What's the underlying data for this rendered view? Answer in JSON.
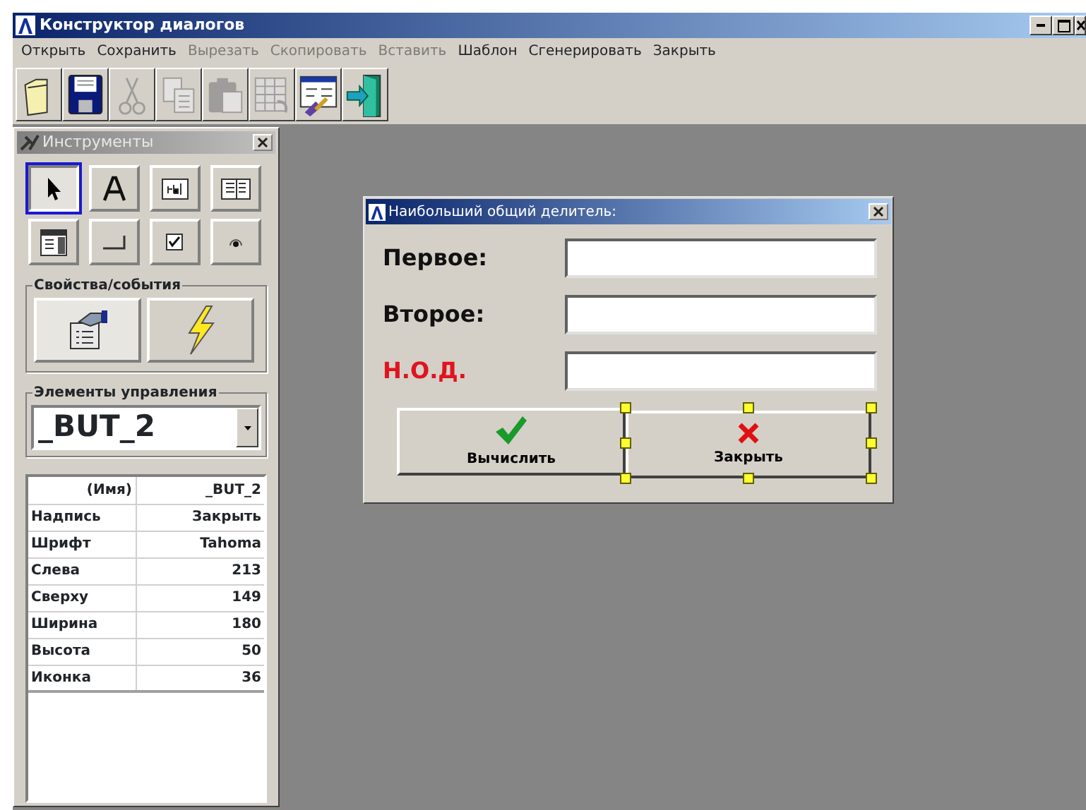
{
  "window": {
    "title": "Конструктор диалогов"
  },
  "menu": [
    {
      "label": "Открыть",
      "disabled": false
    },
    {
      "label": "Сохранить",
      "disabled": false
    },
    {
      "label": "Вырезать",
      "disabled": true
    },
    {
      "label": "Скопировать",
      "disabled": true
    },
    {
      "label": "Вставить",
      "disabled": true
    },
    {
      "label": "Шаблон",
      "disabled": false
    },
    {
      "label": "Сгенерировать",
      "disabled": false
    },
    {
      "label": "Закрыть",
      "disabled": false
    }
  ],
  "toolbar": [
    {
      "kind": "open",
      "disabled": false
    },
    {
      "kind": "save",
      "disabled": false
    },
    {
      "kind": "cut",
      "disabled": true
    },
    {
      "kind": "copy",
      "disabled": true
    },
    {
      "kind": "paste",
      "disabled": true
    },
    {
      "kind": "grid",
      "disabled": true
    },
    {
      "kind": "form",
      "disabled": false
    },
    {
      "kind": "exit",
      "disabled": false
    }
  ],
  "tools_panel": {
    "title": "Инструменты",
    "tools": [
      {
        "kind": "pointer",
        "selected": true
      },
      {
        "kind": "label",
        "selected": false
      },
      {
        "kind": "edit",
        "selected": false
      },
      {
        "kind": "list",
        "selected": false
      },
      {
        "kind": "combo",
        "selected": false
      },
      {
        "kind": "static",
        "selected": false
      },
      {
        "kind": "check",
        "selected": false
      },
      {
        "kind": "radio",
        "selected": false
      }
    ],
    "props_group": {
      "label": "Свойства/события"
    },
    "controls_group": {
      "label": "Элементы управления",
      "value": "_BUT_2"
    },
    "properties": [
      {
        "name": "(Имя)",
        "value": "_BUT_2"
      },
      {
        "name": "Надпись",
        "value": "Закрыть"
      },
      {
        "name": "Шрифт",
        "value": "Tahoma"
      },
      {
        "name": "Слева",
        "value": "213"
      },
      {
        "name": "Сверху",
        "value": "149"
      },
      {
        "name": "Ширина",
        "value": "180"
      },
      {
        "name": "Высота",
        "value": "50"
      },
      {
        "name": "Иконка",
        "value": "36"
      }
    ]
  },
  "dialog": {
    "title": "Наибольший общий делитель:",
    "fields": [
      {
        "label": "Первое:",
        "color": "#111111"
      },
      {
        "label": "Второе:",
        "color": "#111111"
      },
      {
        "label": "Н.О.Д.",
        "color": "#e0141e"
      }
    ],
    "buttons": [
      {
        "label": "Вычислить",
        "kind": "ok",
        "selected": false
      },
      {
        "label": "Закрыть",
        "kind": "cancel",
        "selected": true
      }
    ]
  }
}
